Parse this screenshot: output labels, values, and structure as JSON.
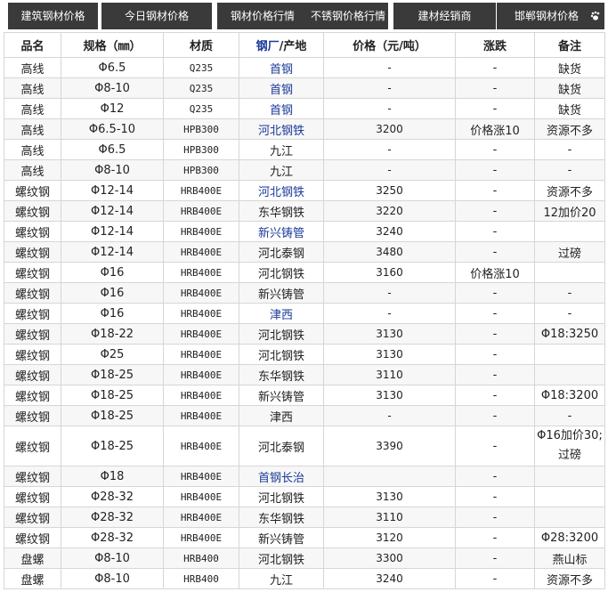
{
  "nav": {
    "items": [
      "建筑钢材价格",
      "今日钢材价格",
      "钢材价格行情",
      "不锈钢价格行情",
      "建材经销商",
      "邯郸钢材价格"
    ],
    "icon": "paw-icon",
    "bg_color": "#3a3a3a"
  },
  "table": {
    "headers": {
      "name": "品名",
      "spec": "规格（㎜）",
      "material": "材质",
      "maker_a": "钢厂",
      "maker_b": "/产地",
      "price": "价格（元/吨）",
      "change": "涨跌",
      "note": "备注"
    },
    "rows": [
      {
        "name": "高线",
        "spec": "Φ6.5",
        "material": "Q235",
        "maker": "首钢",
        "price": "-",
        "change": "-",
        "note": "缺货"
      },
      {
        "name": "高线",
        "spec": "Φ8-10",
        "material": "Q235",
        "maker": "首钢",
        "price": "-",
        "change": "-",
        "note": "缺货"
      },
      {
        "name": "高线",
        "spec": "Φ12",
        "material": "Q235",
        "maker": "首钢",
        "price": "-",
        "change": "-",
        "note": "缺货"
      },
      {
        "name": "高线",
        "spec": "Φ6.5-10",
        "material": "HPB300",
        "maker": "河北钢铁",
        "price": "3200",
        "change": "价格涨10",
        "note": "资源不多"
      },
      {
        "name": "高线",
        "spec": "Φ6.5",
        "material": "HPB300",
        "maker": "九江",
        "price": "-",
        "change": "-",
        "note": "-"
      },
      {
        "name": "高线",
        "spec": "Φ8-10",
        "material": "HPB300",
        "maker": "九江",
        "price": "-",
        "change": "-",
        "note": "-"
      },
      {
        "name": "螺纹钢",
        "spec": "Φ12-14",
        "material": "HRB400E",
        "maker": "河北钢铁",
        "price": "3250",
        "change": "-",
        "note": "资源不多"
      },
      {
        "name": "螺纹钢",
        "spec": "Φ12-14",
        "material": "HRB400E",
        "maker": "东华钢铁",
        "price": "3220",
        "change": "-",
        "note": "12加价20"
      },
      {
        "name": "螺纹钢",
        "spec": "Φ12-14",
        "material": "HRB400E",
        "maker": "新兴铸管",
        "price": "3240",
        "change": "-",
        "note": ""
      },
      {
        "name": "螺纹钢",
        "spec": "Φ12-14",
        "material": "HRB400E",
        "maker": "河北泰钢",
        "price": "3480",
        "change": "-",
        "note": "过磅"
      },
      {
        "name": "螺纹钢",
        "spec": "Φ16",
        "material": "HRB400E",
        "maker": "河北钢铁",
        "price": "3160",
        "change": "价格涨10",
        "note": ""
      },
      {
        "name": "螺纹钢",
        "spec": "Φ16",
        "material": "HRB400E",
        "maker": "新兴铸管",
        "price": "-",
        "change": "-",
        "note": "-"
      },
      {
        "name": "螺纹钢",
        "spec": "Φ16",
        "material": "HRB400E",
        "maker": "津西",
        "price": "-",
        "change": "-",
        "note": "-"
      },
      {
        "name": "螺纹钢",
        "spec": "Φ18-22",
        "material": "HRB400E",
        "maker": "河北钢铁",
        "price": "3130",
        "change": "-",
        "note": "Φ18:3250"
      },
      {
        "name": "螺纹钢",
        "spec": "Φ25",
        "material": "HRB400E",
        "maker": "河北钢铁",
        "price": "3130",
        "change": "-",
        "note": ""
      },
      {
        "name": "螺纹钢",
        "spec": "Φ18-25",
        "material": "HRB400E",
        "maker": "东华钢铁",
        "price": "3110",
        "change": "-",
        "note": ""
      },
      {
        "name": "螺纹钢",
        "spec": "Φ18-25",
        "material": "HRB400E",
        "maker": "新兴铸管",
        "price": "3130",
        "change": "-",
        "note": "Φ18:3200"
      },
      {
        "name": "螺纹钢",
        "spec": "Φ18-25",
        "material": "HRB400E",
        "maker": "津西",
        "price": "-",
        "change": "-",
        "note": "-"
      },
      {
        "name": "螺纹钢",
        "spec": "Φ18-25",
        "material": "HRB400E",
        "maker": "河北泰钢",
        "price": "3390",
        "change": "-",
        "note": "Φ16加价30;过磅"
      },
      {
        "name": "螺纹钢",
        "spec": "Φ18",
        "material": "HRB400E",
        "maker": "首钢长治",
        "price": "",
        "change": "-",
        "note": ""
      },
      {
        "name": "螺纹钢",
        "spec": "Φ28-32",
        "material": "HRB400E",
        "maker": "河北钢铁",
        "price": "3130",
        "change": "-",
        "note": ""
      },
      {
        "name": "螺纹钢",
        "spec": "Φ28-32",
        "material": "HRB400E",
        "maker": "东华钢铁",
        "price": "3110",
        "change": "-",
        "note": ""
      },
      {
        "name": "螺纹钢",
        "spec": "Φ28-32",
        "material": "HRB400E",
        "maker": "新兴铸管",
        "price": "3120",
        "change": "-",
        "note": "Φ28:3200"
      },
      {
        "name": "盘螺",
        "spec": "Φ8-10",
        "material": "HRB400",
        "maker": "河北钢铁",
        "price": "3300",
        "change": "-",
        "note": "燕山标"
      },
      {
        "name": "盘螺",
        "spec": "Φ8-10",
        "material": "HRB400",
        "maker": "九江",
        "price": "3240",
        "change": "-",
        "note": "资源不多"
      }
    ],
    "link_color": "#1b3a9a"
  }
}
